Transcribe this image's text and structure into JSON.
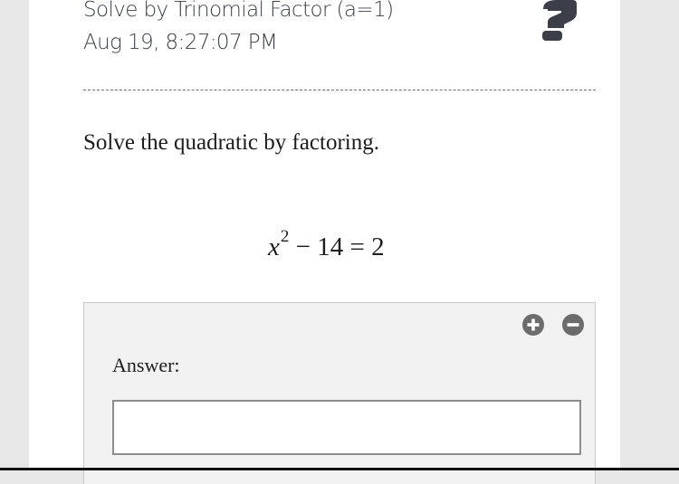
{
  "header": {
    "title": "Solve by Trinomial Factor (a=1)",
    "timestamp": "Aug 19, 8:27:07 PM",
    "help_icon": "question-mark-icon"
  },
  "problem": {
    "prompt": "Solve the quadratic by factoring.",
    "equation": {
      "variable": "x",
      "exponent": "2",
      "rest": " − 14 = 2"
    }
  },
  "answer": {
    "label": "Answer:",
    "value": "",
    "zoom_in_icon": "plus-circle-icon",
    "zoom_out_icon": "minus-circle-icon"
  },
  "colors": {
    "header_text": "#3c3f49",
    "icon_dark": "#3c3f49",
    "zoom_icons": "#6c6c6c",
    "panel_bg": "#f2f2f2"
  }
}
